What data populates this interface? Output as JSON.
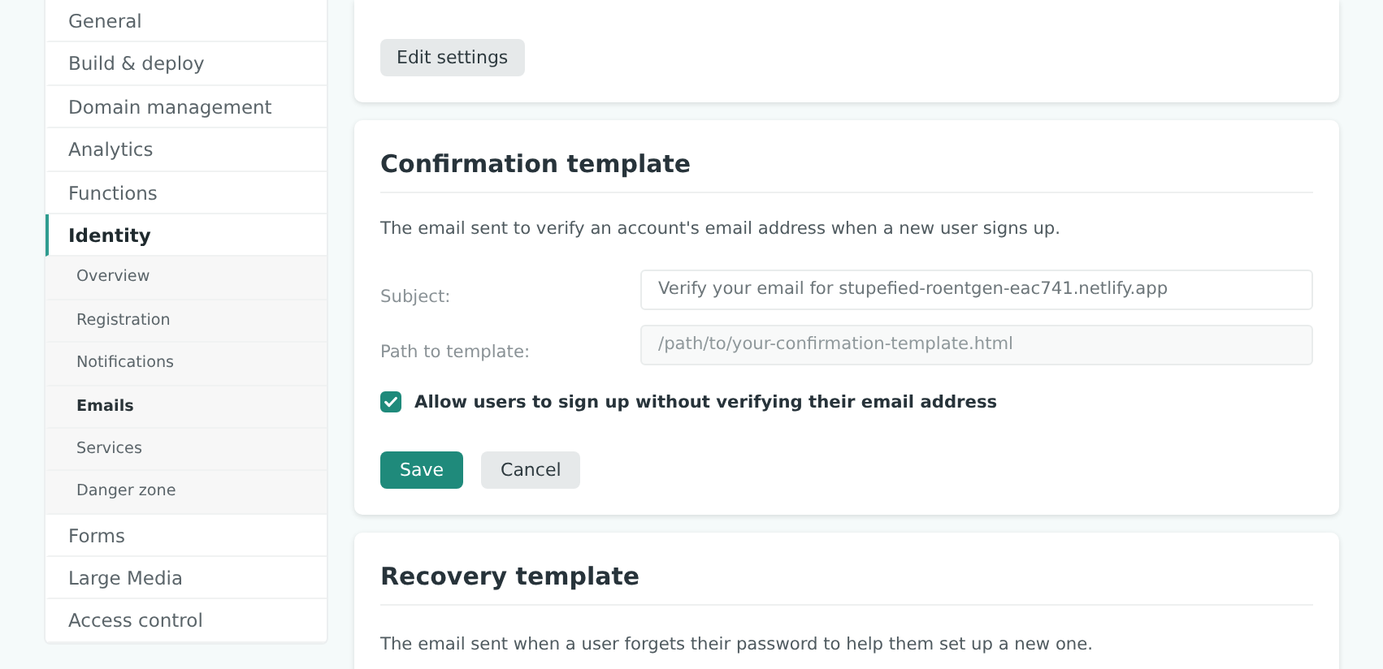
{
  "sidebar": {
    "items": [
      {
        "label": "General",
        "selected": false
      },
      {
        "label": "Build & deploy",
        "selected": false
      },
      {
        "label": "Domain management",
        "selected": false
      },
      {
        "label": "Analytics",
        "selected": false
      },
      {
        "label": "Functions",
        "selected": false
      },
      {
        "label": "Identity",
        "selected": true,
        "expanded": true,
        "children": [
          {
            "label": "Overview",
            "selected": false
          },
          {
            "label": "Registration",
            "selected": false
          },
          {
            "label": "Notifications",
            "selected": false
          },
          {
            "label": "Emails",
            "selected": true
          },
          {
            "label": "Services",
            "selected": false
          },
          {
            "label": "Danger zone",
            "selected": false
          }
        ]
      },
      {
        "label": "Forms",
        "selected": false
      },
      {
        "label": "Large Media",
        "selected": false
      },
      {
        "label": "Access control",
        "selected": false
      }
    ]
  },
  "top_card": {
    "button": "Edit settings"
  },
  "confirmation_template": {
    "title": "Confirmation template",
    "description": "The email sent to verify an account's email address when a new user signs up.",
    "fields": [
      {
        "label": "Subject:",
        "value": "Verify your email for stupefied-roentgen-eac741.netlify.app"
      },
      {
        "label": "Path to template:",
        "placeholder": "/path/to/your-confirmation-template.html"
      }
    ],
    "checkbox": {
      "label": "Allow users to sign up without verifying their email address",
      "checked": true
    },
    "buttons": [
      {
        "label": "Save",
        "kind": "primary"
      },
      {
        "label": "Cancel",
        "kind": "secondary"
      }
    ]
  },
  "recovery_template": {
    "title": "Recovery template",
    "description": "The email sent when a user forgets their password to help them set up a new one."
  }
}
